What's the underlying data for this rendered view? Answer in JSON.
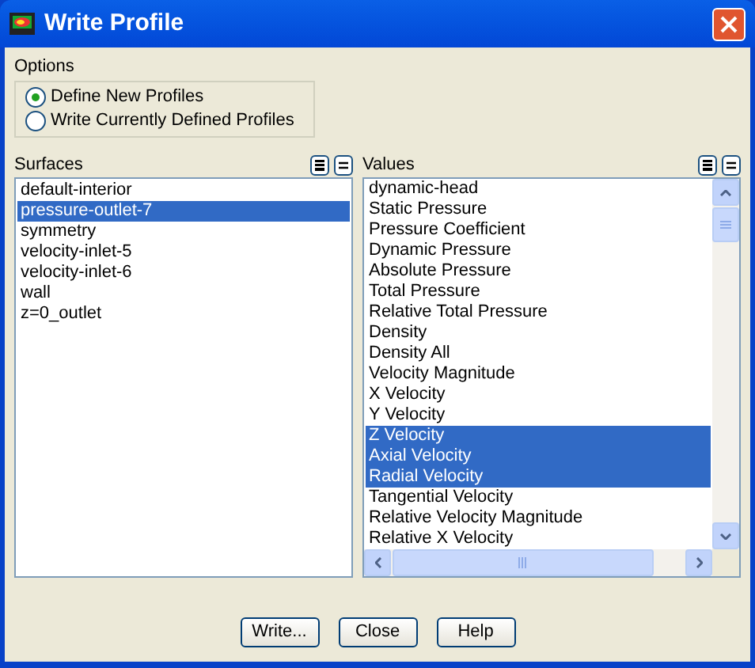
{
  "window": {
    "title": "Write Profile"
  },
  "options": {
    "label": "Options",
    "items": [
      {
        "label": "Define New Profiles",
        "selected": true
      },
      {
        "label": "Write Currently Defined Profiles",
        "selected": false
      }
    ]
  },
  "surfaces": {
    "label": "Surfaces",
    "items": [
      {
        "label": "default-interior",
        "selected": false
      },
      {
        "label": "pressure-outlet-7",
        "selected": true
      },
      {
        "label": "symmetry",
        "selected": false
      },
      {
        "label": "velocity-inlet-5",
        "selected": false
      },
      {
        "label": "velocity-inlet-6",
        "selected": false
      },
      {
        "label": "wall",
        "selected": false
      },
      {
        "label": "z=0_outlet",
        "selected": false
      }
    ]
  },
  "values": {
    "label": "Values",
    "items": [
      {
        "label": "dynamic-head",
        "selected": false
      },
      {
        "label": "Static Pressure",
        "selected": false
      },
      {
        "label": "Pressure Coefficient",
        "selected": false
      },
      {
        "label": "Dynamic Pressure",
        "selected": false
      },
      {
        "label": "Absolute Pressure",
        "selected": false
      },
      {
        "label": "Total Pressure",
        "selected": false
      },
      {
        "label": "Relative Total Pressure",
        "selected": false
      },
      {
        "label": "Density",
        "selected": false
      },
      {
        "label": "Density All",
        "selected": false
      },
      {
        "label": "Velocity Magnitude",
        "selected": false
      },
      {
        "label": "X Velocity",
        "selected": false
      },
      {
        "label": "Y Velocity",
        "selected": false
      },
      {
        "label": "Z Velocity",
        "selected": true
      },
      {
        "label": "Axial Velocity",
        "selected": true
      },
      {
        "label": "Radial Velocity",
        "selected": true
      },
      {
        "label": "Tangential Velocity",
        "selected": false
      },
      {
        "label": "Relative Velocity Magnitude",
        "selected": false
      },
      {
        "label": "Relative X Velocity",
        "selected": false
      }
    ]
  },
  "buttons": [
    "Write...",
    "Close",
    "Help"
  ]
}
